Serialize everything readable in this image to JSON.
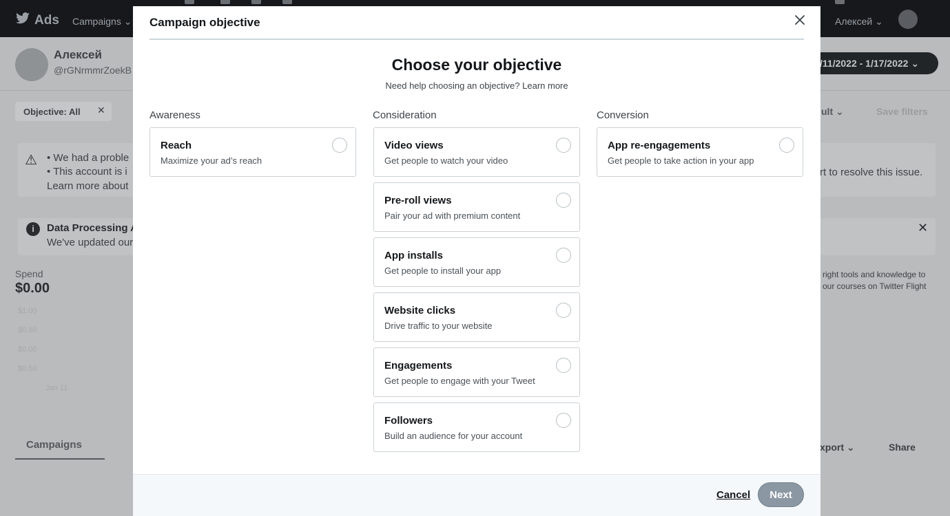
{
  "background": {
    "brand": "Ads",
    "nav_campaigns": "Campaigns ⌄",
    "user_menu": "Алексей ⌄",
    "profile_name": "Алексей",
    "profile_handle": "@rGNrmmrZoekB",
    "date_range": "/11/2022 - 1/17/2022 ⌄",
    "filter_chip": "Objective: All",
    "filter_close": "✕",
    "save_filters": "Save filters",
    "ult_label": "ult ⌄",
    "alert_line1": "•  We had a proble",
    "alert_line2": "•  This account is i",
    "alert_line3": "Learn more about",
    "alert_right": "rt to resolve this issue.",
    "info_title": "Data Processing A",
    "info_text": "We've updated our",
    "info_close": "✕",
    "spend_label": "Spend",
    "spend_value": "$0.00",
    "axis_labels": [
      "$1.00",
      "$0.50",
      "$0.00",
      "$0.50"
    ],
    "date_tick": "Jan 11",
    "side_text1": "right tools and knowledge to",
    "side_text2": "our courses on Twitter Flight",
    "tab_campaigns": "Campaigns",
    "export": "xport ⌄",
    "share": "Share"
  },
  "modal": {
    "title": "Campaign objective",
    "headline": "Choose your objective",
    "help_text": "Need help choosing an objective?",
    "learn_more": "Learn more",
    "columns": [
      {
        "title": "Awareness",
        "items": [
          {
            "title": "Reach",
            "description": "Maximize your ad’s reach"
          }
        ]
      },
      {
        "title": "Consideration",
        "items": [
          {
            "title": "Video views",
            "description": "Get people to watch your video"
          },
          {
            "title": "Pre-roll views",
            "description": "Pair your ad with premium content"
          },
          {
            "title": "App installs",
            "description": "Get people to install your app"
          },
          {
            "title": "Website clicks",
            "description": "Drive traffic to your website"
          },
          {
            "title": "Engagements",
            "description": "Get people to engage with your Tweet"
          },
          {
            "title": "Followers",
            "description": "Build an audience for your account"
          }
        ]
      },
      {
        "title": "Conversion",
        "items": [
          {
            "title": "App re-engagements",
            "description": "Get people to take action in your app"
          }
        ]
      }
    ],
    "cancel_label": "Cancel",
    "next_label": "Next"
  }
}
